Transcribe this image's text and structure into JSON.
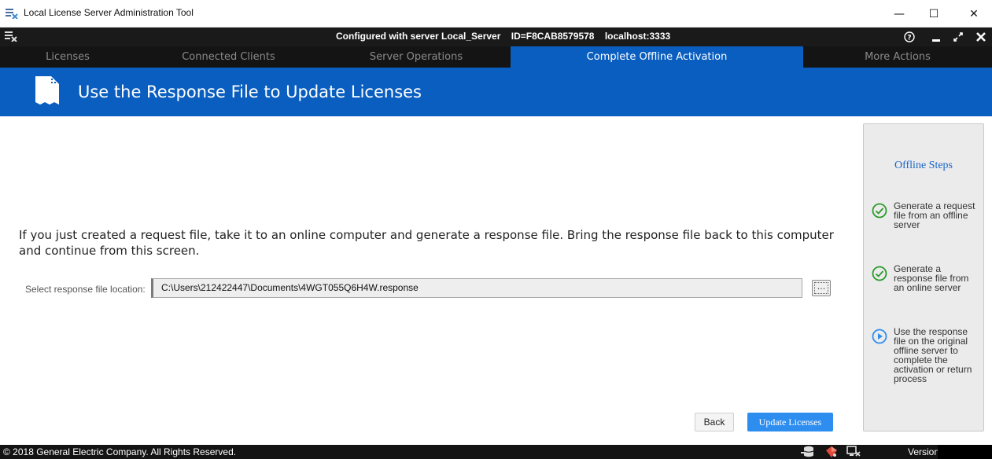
{
  "window": {
    "title": "Local License Server Administration Tool",
    "controls": {
      "minimize": "—",
      "maximize": "☐",
      "close": "✕"
    }
  },
  "header": {
    "configured": "Configured with server Local_Server",
    "id": "ID=F8CAB8579578",
    "host": "localhost:3333",
    "help": "?"
  },
  "tabs": [
    {
      "label": "Licenses",
      "active": false
    },
    {
      "label": "Connected Clients",
      "active": false
    },
    {
      "label": "Server Operations",
      "active": false
    },
    {
      "label": "Complete Offline Activation",
      "active": true
    },
    {
      "label": "More Actions",
      "active": false
    }
  ],
  "banner": {
    "title": "Use the Response File to Update Licenses"
  },
  "main": {
    "instructions": "If you just created a request file, take it to an online computer and generate a response file. Bring the response file back to this computer and continue from this screen.",
    "file_label": "Select response file location:",
    "file_value": "C:\\Users\\212422447\\Documents\\4WGT055Q6H4W.response",
    "browse_label": "...",
    "back_label": "Back",
    "update_label": "Update Licenses"
  },
  "steps": {
    "title": "Offline Steps",
    "items": [
      {
        "text": "Generate a request file from an offline server",
        "state": "done"
      },
      {
        "text": "Generate a response file from an online server",
        "state": "done"
      },
      {
        "text": "Use the response file on the original offline server to complete the activation or return process",
        "state": "current"
      }
    ]
  },
  "footer": {
    "copyright": "© 2018 General Electric Company.  All Rights Reserved.",
    "version_label": "Version:",
    "version_value": ""
  },
  "colors": {
    "accent": "#0a5ebf",
    "button_primary": "#2e8ef0",
    "step_done": "#2a9a2a",
    "step_current": "#2e8ef0",
    "header_bg": "#1a1a1a"
  }
}
